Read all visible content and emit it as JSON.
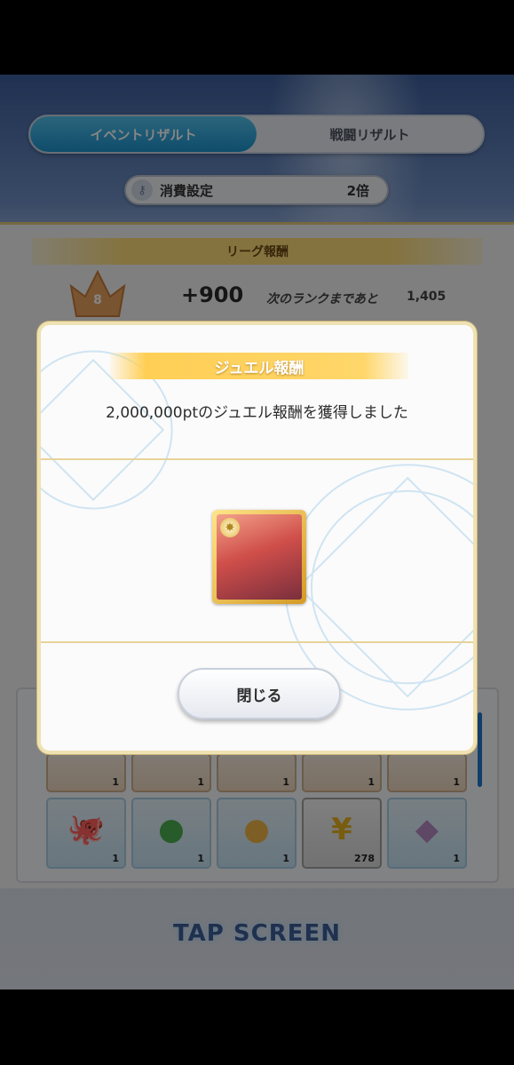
{
  "tabs": [
    {
      "label": "イベントリザルト",
      "active": true
    },
    {
      "label": "戦闘リザルト",
      "active": false
    }
  ],
  "consume": {
    "label": "消費設定",
    "value": "2倍",
    "icon": "key-icon"
  },
  "league": {
    "banner": "リーグ報酬",
    "rank": "8",
    "points": "+900",
    "next_rank_label": "次のランクまであと",
    "next_rank_value": "1,405"
  },
  "items": [
    {
      "icon": "slime-icon",
      "qty": "1"
    },
    {
      "icon": "bowl-icon",
      "qty": "1"
    },
    {
      "icon": "shrimp-icon",
      "qty": "1"
    },
    {
      "icon": "ginger-icon",
      "qty": "1"
    },
    {
      "icon": "bamboo-icon",
      "qty": "1"
    },
    {
      "icon": "octopus-icon",
      "qty": "1"
    },
    {
      "icon": "tomato-icon",
      "qty": "1"
    },
    {
      "icon": "egg-icon",
      "qty": "1"
    },
    {
      "icon": "yen-icon",
      "qty": "278"
    },
    {
      "icon": "fish-icon",
      "qty": "1"
    }
  ],
  "tap_screen": "TAP SCREEN",
  "modal": {
    "title": "ジュエル報酬",
    "message": "2,000,000ptのジュエル報酬を獲得しました",
    "reward_icon": "character-card-icon",
    "close_label": "閉じる"
  },
  "colors": {
    "accent": "#1c93cf",
    "gold": "#ffcf55",
    "dim": "#000000"
  }
}
